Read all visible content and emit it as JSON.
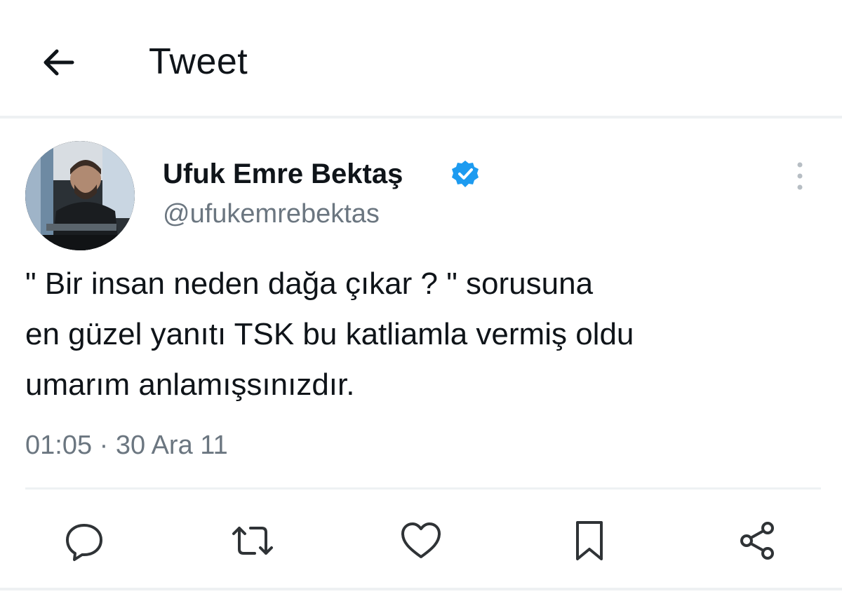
{
  "header": {
    "title": "Tweet",
    "back_icon": "arrow-left-icon"
  },
  "tweet": {
    "author": {
      "display_name": "Ufuk Emre Bektaş",
      "handle": "@ufukemrebektas",
      "verified": true,
      "verified_color": "#1d9bf0"
    },
    "text": "\" Bir insan neden dağa çıkar ? \" sorusuna\nen güzel yanıtı TSK bu katliamla vermiş oldu\numarım anlamışsınızdır.",
    "timestamp": "01:05 · 30 Ara 11",
    "more_icon": "more-vertical-icon"
  },
  "actions": [
    {
      "icon": "reply-icon"
    },
    {
      "icon": "retweet-icon"
    },
    {
      "icon": "like-icon"
    },
    {
      "icon": "bookmark-icon"
    },
    {
      "icon": "share-icon"
    }
  ],
  "colors": {
    "text_primary": "#0f1419",
    "text_secondary": "#6b7680",
    "divider": "#eef1f3"
  }
}
